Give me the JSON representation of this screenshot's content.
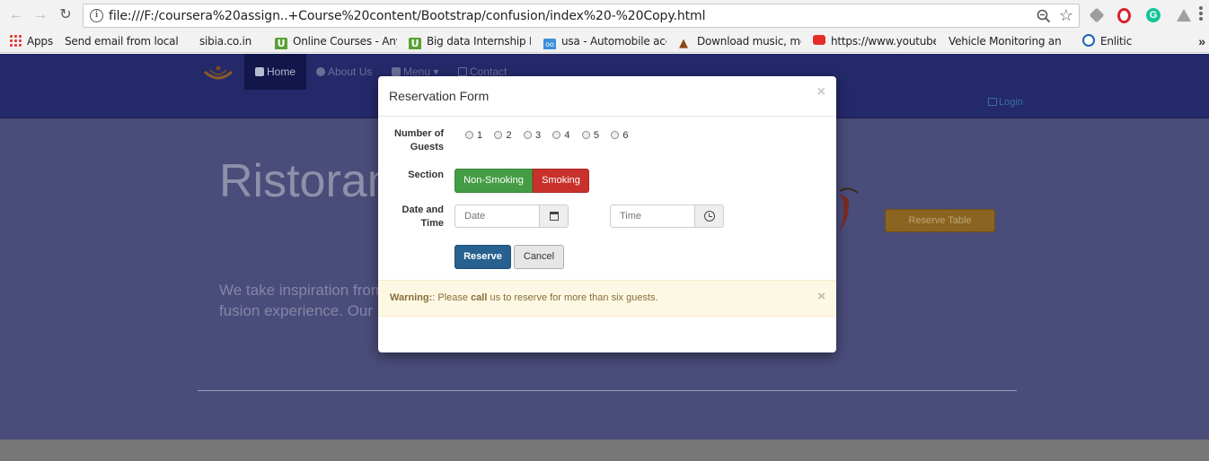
{
  "browser": {
    "url": "file:///F:/coursera%20assign..+Course%20content/Bootstrap/confusion/index%20-%20Copy.html",
    "bookmarks": [
      {
        "label": "Apps",
        "icon": "apps-grid-icon"
      },
      {
        "label": "Send email from local",
        "icon": "page-icon"
      },
      {
        "label": "sibia.co.in",
        "icon": "page-icon"
      },
      {
        "label": "Online Courses - Anyt",
        "icon": "udemy-icon"
      },
      {
        "label": "Big data Internship Pr",
        "icon": "udemy-icon"
      },
      {
        "label": "usa - Automobile acci",
        "icon": "qq-icon"
      },
      {
        "label": "Download music, mov",
        "icon": "campfire-icon"
      },
      {
        "label": "https://www.youtube.",
        "icon": "youtube-icon"
      },
      {
        "label": "Vehicle Monitoring an",
        "icon": "page-icon"
      },
      {
        "label": "Enlitic",
        "icon": "enlitic-icon"
      }
    ],
    "more_label": "»"
  },
  "site": {
    "nav": [
      {
        "label": "Home",
        "icon": "home-icon"
      },
      {
        "label": "About Us",
        "icon": "info-icon"
      },
      {
        "label": "Menu ▾",
        "icon": "list-icon"
      },
      {
        "label": "Contact",
        "icon": "envelope-icon"
      }
    ],
    "login_label": "Login",
    "jumbotron": {
      "title": "Ristoran",
      "text_lines": [
        "We take inspiration from",
        "fusion experience. Our"
      ]
    },
    "reserve_table_label": "Reserve Table"
  },
  "modal": {
    "title": "Reservation Form",
    "close": "×",
    "guests_label_line1": "Number of",
    "guests_label_line2": "Guests",
    "guest_options": [
      "1",
      "2",
      "3",
      "4",
      "5",
      "6"
    ],
    "section_label": "Section",
    "section_options": [
      "Non-Smoking",
      "Smoking"
    ],
    "datetime_label_line1": "Date and",
    "datetime_label_line2": "Time",
    "date_placeholder": "Date",
    "time_placeholder": "Time",
    "reserve_label": "Reserve",
    "cancel_label": "Cancel",
    "alert": {
      "strong": "Warning:",
      "pre": ": Please ",
      "emph": "call",
      "post": " us to reserve for more than six guests.",
      "close": "×"
    }
  },
  "colors": {
    "success": "#449d44",
    "danger": "#c9302c",
    "primary": "#286090",
    "warning_bg": "#fcf8e3"
  }
}
